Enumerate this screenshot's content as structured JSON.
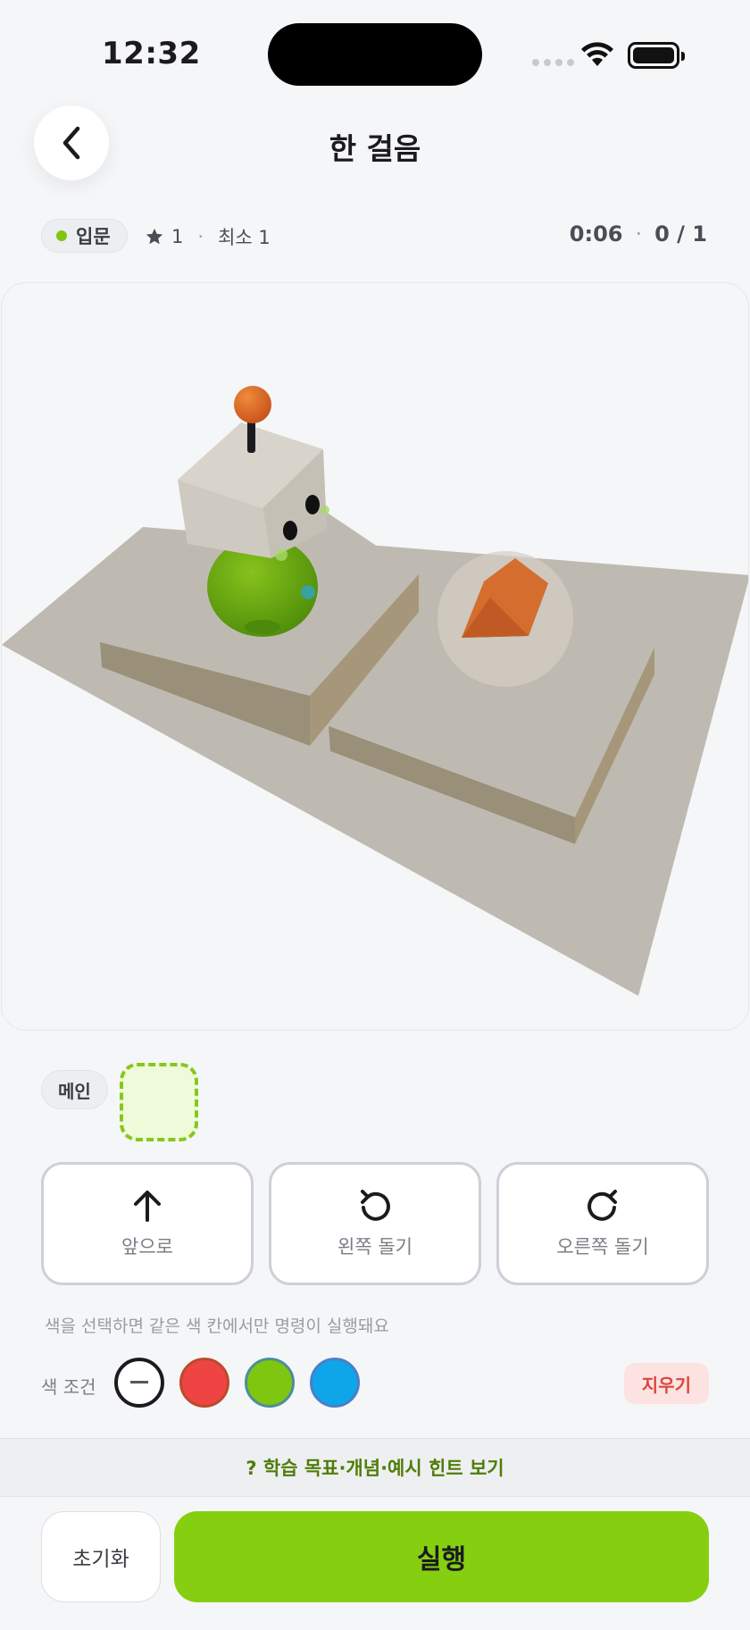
{
  "status_bar": {
    "time": "12:32"
  },
  "header": {
    "title": "한 걸음"
  },
  "meta": {
    "level": "입문",
    "level_color": "#7ec60f",
    "stars": "1",
    "dot": "·",
    "min_steps": "최소 1",
    "timer": "0:06",
    "progress": "0 / 1"
  },
  "program": {
    "main_label": "메인",
    "slot_color": "#86c81b"
  },
  "commands": [
    {
      "icon": "arrow-up-icon",
      "label": "앞으로"
    },
    {
      "icon": "rotate-left-icon",
      "label": "왼쪽 돌기"
    },
    {
      "icon": "rotate-right-icon",
      "label": "오른쪽 돌기"
    }
  ],
  "color_hint": "색을 선택하면 같은 색 칸에서만 명령이 실행돼요",
  "color_condition": {
    "label": "색 조건",
    "options": [
      {
        "name": "none",
        "color": "#ffffff"
      },
      {
        "name": "red",
        "color": "#ef4444"
      },
      {
        "name": "green",
        "color": "#7ec60f"
      },
      {
        "name": "blue",
        "color": "#0ea5e9"
      }
    ],
    "erase_label": "지우기"
  },
  "hint_bar": "? 학습 목표·개념·예시 힌트 보기",
  "footer": {
    "reset_label": "초기화",
    "run_label": "실행"
  }
}
